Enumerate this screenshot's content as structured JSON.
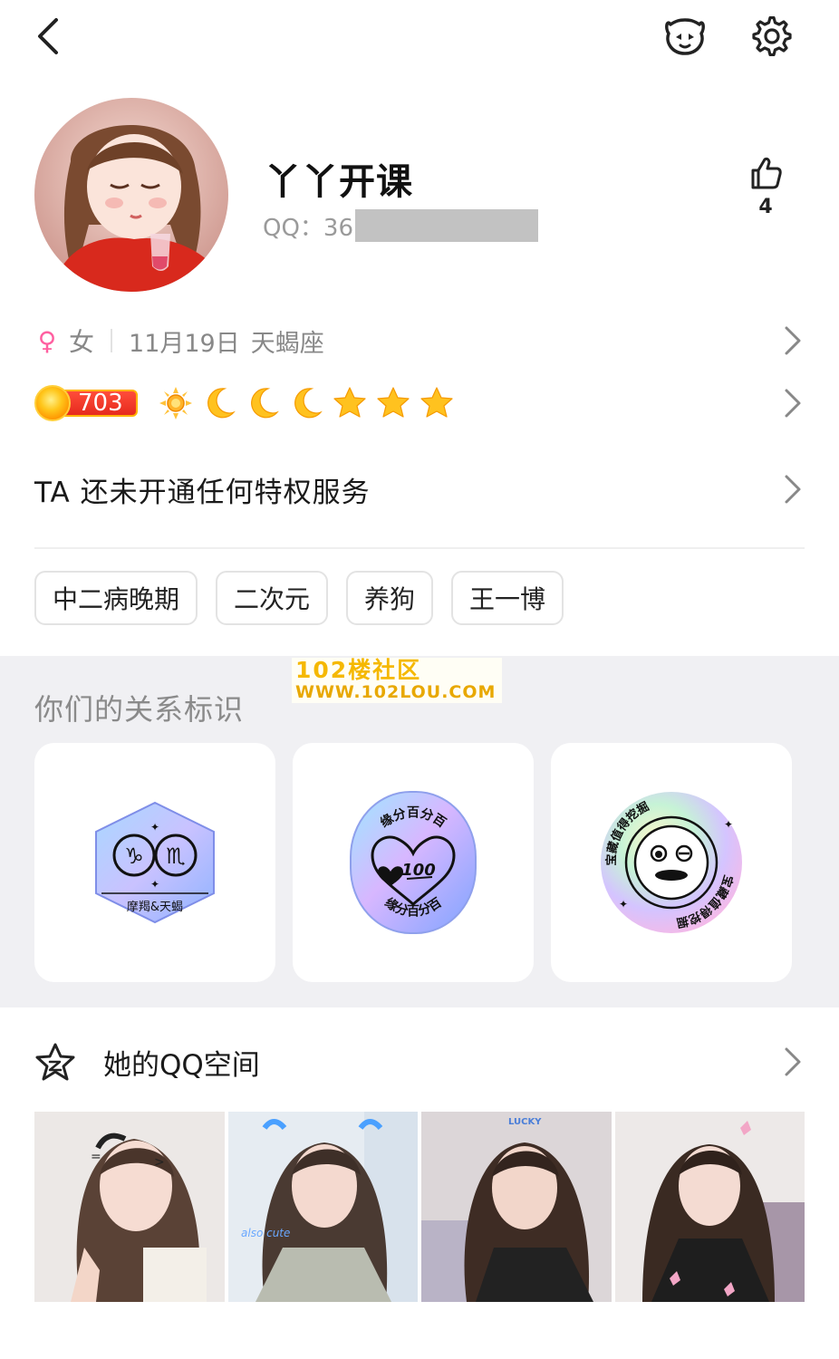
{
  "header": {
    "back_icon": "back-arrow-icon",
    "pet_icon": "pet-face-icon",
    "settings_icon": "gear-icon"
  },
  "profile": {
    "nickname": "丫丫开课",
    "qq_label": "QQ：36",
    "like_count": "4",
    "gender_symbol": "♀",
    "gender": "女",
    "birthday": "11月19日",
    "zodiac": "天蝎座",
    "level": "703",
    "level_icons": [
      "sun",
      "moon",
      "moon",
      "moon",
      "star",
      "star",
      "star"
    ],
    "privilege_text": "TA 还未开通任何特权服务",
    "tags": [
      "中二病晚期",
      "二次元",
      "养狗",
      "王一博"
    ]
  },
  "relation": {
    "title": "你们的关系标识",
    "badges": [
      {
        "label": "摩羯&天蝎",
        "icon": "zodiac-badge-icon"
      },
      {
        "label": "缘分百分百",
        "icon": "heart-100-badge-icon"
      },
      {
        "label": "宝藏值得挖掘",
        "icon": "treasure-face-badge-icon"
      }
    ]
  },
  "watermark": {
    "line1": "102楼社区",
    "line2": "WWW.102LOU.COM"
  },
  "qzone": {
    "title": "她的QQ空间",
    "photo_count": 4,
    "photo_texts": [
      "",
      "also cute",
      "LUCKY",
      ""
    ]
  },
  "colors": {
    "accent_pink": "#ff5fa0",
    "level_red": "#e62a1d",
    "muted_text": "#888888",
    "section_bg": "#f0f0f3"
  }
}
